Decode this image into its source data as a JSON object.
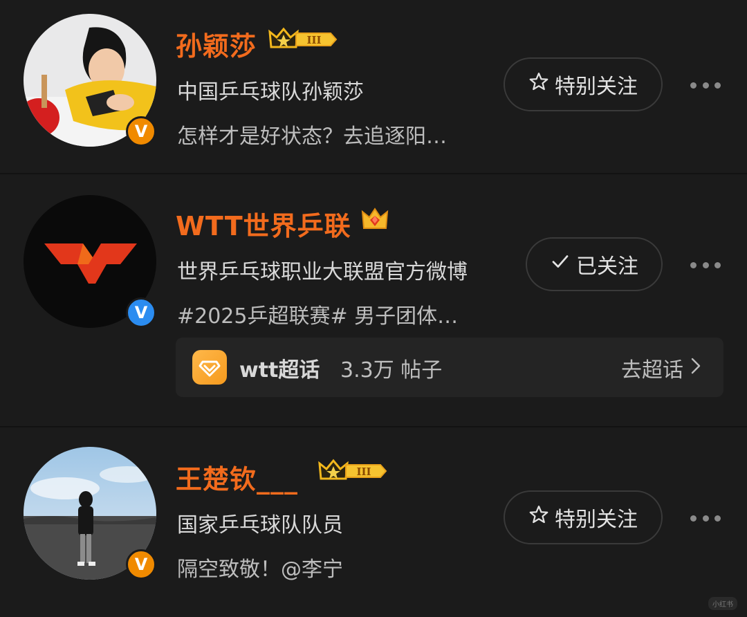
{
  "users": [
    {
      "name": "孙颖莎",
      "description": "中国乒乓球队孙颖莎",
      "latest_post": "怎样才是好状态？去追逐阳…",
      "verified": "orange",
      "level_badge": "III",
      "follow_button": {
        "icon": "star-outline-icon",
        "label": "特别关注"
      }
    },
    {
      "name": "WTT世界乒联",
      "description": "世界乒乓球职业大联盟官方微博",
      "latest_post": "#2025乒超联赛#   男子团体…",
      "verified": "blue",
      "level_badge": "",
      "follow_button": {
        "icon": "check-icon",
        "label": "已关注"
      },
      "super_topic": {
        "name": "wtt超话",
        "count": "3.3万 帖子",
        "go_label": "去超话"
      }
    },
    {
      "name": "王楚钦___",
      "description": "国家乒乓球队队员",
      "latest_post": "隔空致敬！@李宁",
      "verified": "orange",
      "level_badge": "III",
      "follow_button": {
        "icon": "star-outline-icon",
        "label": "特别关注"
      }
    }
  ],
  "watermark": "小红书",
  "colors": {
    "background": "#1b1b1b",
    "name_orange": "#f26b1d",
    "verified_orange": "#f08a00",
    "verified_blue": "#2b8cf0"
  }
}
